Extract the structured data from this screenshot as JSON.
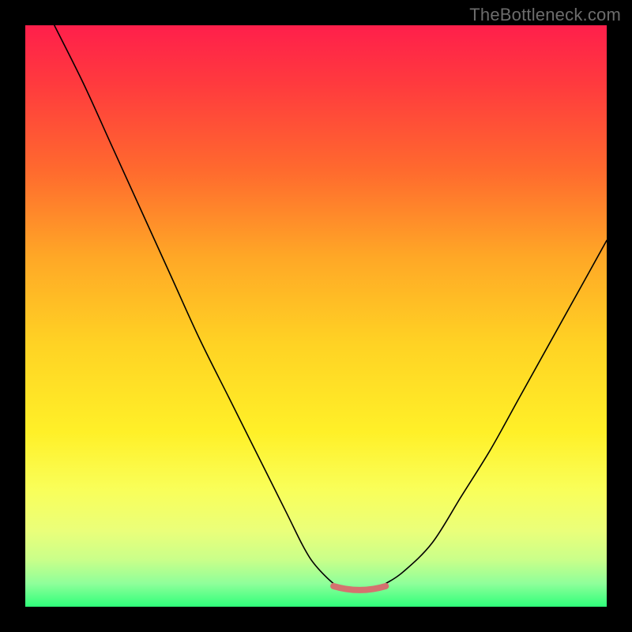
{
  "watermark": {
    "text": "TheBottleneck.com"
  },
  "colors": {
    "frame": "#000000",
    "curve": "#000000",
    "cap": "#d4726f",
    "gradient_top": "#ff1f4b",
    "gradient_bottom": "#2fff7a"
  },
  "chart_data": {
    "type": "line",
    "title": "",
    "xlabel": "",
    "ylabel": "",
    "xlim": [
      0,
      100
    ],
    "ylim": [
      0,
      100
    ],
    "grid": false,
    "series": [
      {
        "name": "bottleneck-curve",
        "x": [
          5,
          10,
          15,
          20,
          25,
          30,
          35,
          40,
          45,
          48,
          50,
          53,
          55,
          58,
          60,
          62,
          65,
          70,
          75,
          80,
          85,
          90,
          95,
          100
        ],
        "y": [
          100,
          90,
          79,
          68,
          57,
          46,
          36,
          26,
          16,
          10,
          7,
          4,
          3,
          3,
          3,
          4,
          6,
          11,
          19,
          27,
          36,
          45,
          54,
          63
        ]
      }
    ],
    "annotations": [
      {
        "name": "trough-cap",
        "shape": "arc",
        "x_range": [
          53,
          62
        ],
        "y": 3,
        "color": "#d4726f"
      }
    ]
  }
}
